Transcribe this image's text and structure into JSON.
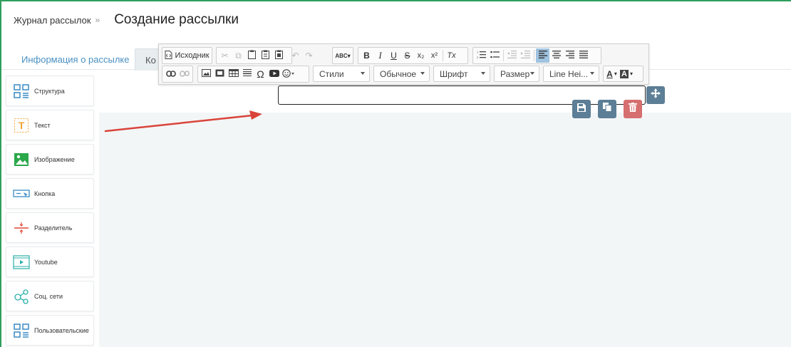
{
  "header": {
    "breadcrumb": "Журнал рассылок",
    "breadcrumb_sep": "»",
    "title": "Создание рассылки"
  },
  "tabs": [
    {
      "label": "Информация о рассылке"
    },
    {
      "label": "Ко"
    }
  ],
  "toolbar": {
    "source_label": "Исходник",
    "styles": "Стили",
    "format": "Обычное",
    "font": "Шрифт",
    "size": "Размер",
    "line_height": "Line Hei...",
    "bold": "B",
    "italic": "I",
    "underline": "U",
    "strike": "S",
    "subscript": "x₂",
    "superscript": "x²",
    "clear_format": "Tx",
    "omega": "Ω",
    "text_color": "A",
    "bg_color": "A"
  },
  "sidebar": {
    "items": [
      {
        "label": "Структура",
        "icon": "structure-icon"
      },
      {
        "label": "Текст",
        "icon": "text-icon"
      },
      {
        "label": "Изображение",
        "icon": "image-icon"
      },
      {
        "label": "Кнопка",
        "icon": "button-icon"
      },
      {
        "label": "Разделитель",
        "icon": "divider-icon"
      },
      {
        "label": "Youtube",
        "icon": "video-icon"
      },
      {
        "label": "Соц. сети",
        "icon": "share-icon"
      },
      {
        "label": "Пользовательские",
        "icon": "custom-icon"
      }
    ]
  },
  "colors": {
    "accent": "#4a90c2",
    "action": "#5c7e96",
    "delete": "#d66f6f",
    "frame": "#2e9e5e",
    "arrow": "#d9443a"
  }
}
